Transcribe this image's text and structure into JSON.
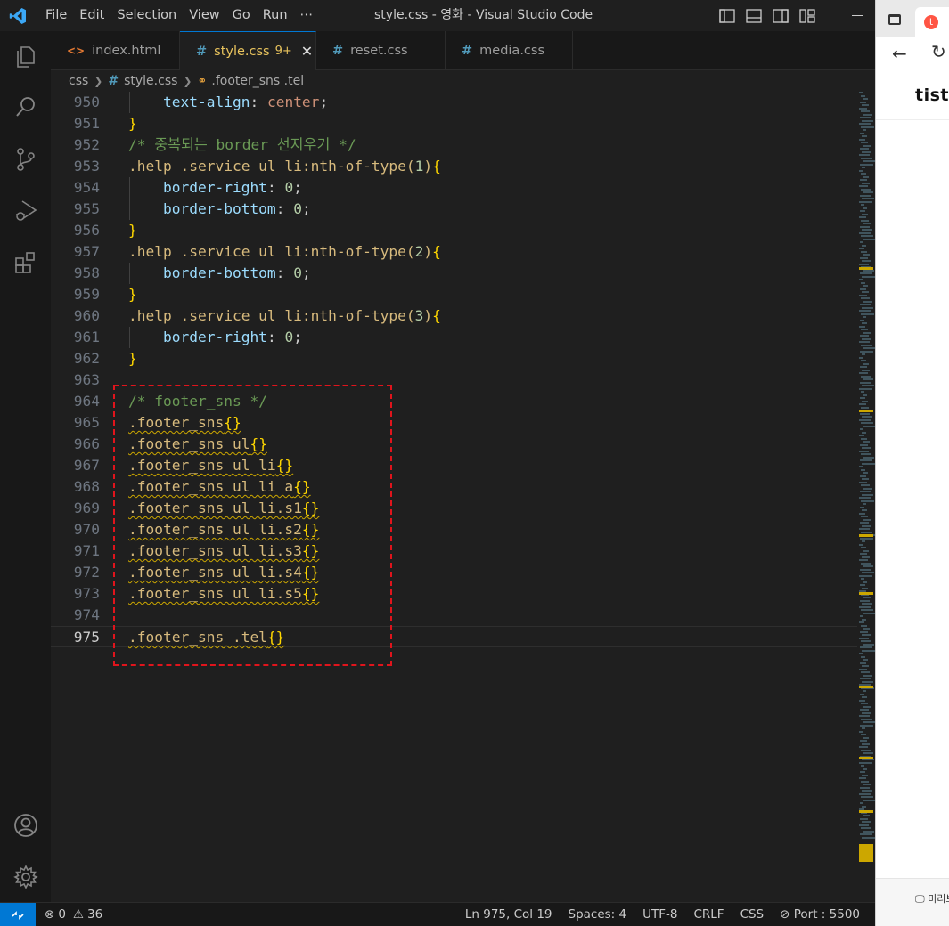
{
  "window": {
    "title": "style.css - 영화 - Visual Studio Code",
    "menu": [
      "File",
      "Edit",
      "Selection",
      "View",
      "Go",
      "Run",
      "⋯"
    ]
  },
  "tabs": [
    {
      "label": "index.html",
      "icon": "html-file-icon",
      "active": false
    },
    {
      "label": "style.css",
      "icon": "css-file-icon",
      "active": true,
      "badge": "9+"
    },
    {
      "label": "reset.css",
      "icon": "css-file-icon",
      "active": false
    },
    {
      "label": "media.css",
      "icon": "css-file-icon",
      "active": false
    }
  ],
  "breadcrumb": {
    "folder": "css",
    "file": "style.css",
    "symbol": ".footer_sns .tel"
  },
  "editor": {
    "lines": [
      {
        "n": "950",
        "ind": true,
        "t": [
          [
            "prop",
            "text-align"
          ],
          [
            "punc",
            ": "
          ],
          [
            "val",
            "center"
          ],
          [
            "punc",
            ";"
          ]
        ]
      },
      {
        "n": "951",
        "ind": false,
        "t": [
          [
            "brace",
            "}"
          ]
        ]
      },
      {
        "n": "952",
        "ind": false,
        "t": [
          [
            "com",
            "/* 중복되는 border 선지우기 */"
          ]
        ]
      },
      {
        "n": "953",
        "ind": false,
        "t": [
          [
            "sel",
            ".help .service ul li:nth-of-type("
          ],
          [
            "num",
            "1"
          ],
          [
            "sel",
            ")"
          ],
          [
            "brace",
            "{"
          ]
        ]
      },
      {
        "n": "954",
        "ind": true,
        "t": [
          [
            "prop",
            "border-right"
          ],
          [
            "punc",
            ": "
          ],
          [
            "num",
            "0"
          ],
          [
            "punc",
            ";"
          ]
        ]
      },
      {
        "n": "955",
        "ind": true,
        "t": [
          [
            "prop",
            "border-bottom"
          ],
          [
            "punc",
            ": "
          ],
          [
            "num",
            "0"
          ],
          [
            "punc",
            ";"
          ]
        ]
      },
      {
        "n": "956",
        "ind": false,
        "t": [
          [
            "brace",
            "}"
          ]
        ]
      },
      {
        "n": "957",
        "ind": false,
        "t": [
          [
            "sel",
            ".help .service ul li:nth-of-type("
          ],
          [
            "num",
            "2"
          ],
          [
            "sel",
            ")"
          ],
          [
            "brace",
            "{"
          ]
        ]
      },
      {
        "n": "958",
        "ind": true,
        "t": [
          [
            "prop",
            "border-bottom"
          ],
          [
            "punc",
            ": "
          ],
          [
            "num",
            "0"
          ],
          [
            "punc",
            ";"
          ]
        ]
      },
      {
        "n": "959",
        "ind": false,
        "t": [
          [
            "brace",
            "}"
          ]
        ]
      },
      {
        "n": "960",
        "ind": false,
        "t": [
          [
            "sel",
            ".help .service ul li:nth-of-type("
          ],
          [
            "num",
            "3"
          ],
          [
            "sel",
            ")"
          ],
          [
            "brace",
            "{"
          ]
        ]
      },
      {
        "n": "961",
        "ind": true,
        "t": [
          [
            "prop",
            "border-right"
          ],
          [
            "punc",
            ": "
          ],
          [
            "num",
            "0"
          ],
          [
            "punc",
            ";"
          ]
        ]
      },
      {
        "n": "962",
        "ind": false,
        "t": [
          [
            "brace",
            "}"
          ]
        ]
      },
      {
        "n": "963",
        "ind": false,
        "t": []
      },
      {
        "n": "964",
        "ind": false,
        "t": [
          [
            "com",
            "/* footer_sns */"
          ]
        ]
      },
      {
        "n": "965",
        "ind": false,
        "sq": true,
        "t": [
          [
            "sel",
            ".footer_sns"
          ],
          [
            "brace",
            "{}"
          ]
        ]
      },
      {
        "n": "966",
        "ind": false,
        "sq": true,
        "t": [
          [
            "sel",
            ".footer_sns ul"
          ],
          [
            "brace",
            "{}"
          ]
        ]
      },
      {
        "n": "967",
        "ind": false,
        "sq": true,
        "t": [
          [
            "sel",
            ".footer_sns ul li"
          ],
          [
            "brace",
            "{}"
          ]
        ]
      },
      {
        "n": "968",
        "ind": false,
        "sq": true,
        "t": [
          [
            "sel",
            ".footer_sns ul li a"
          ],
          [
            "brace",
            "{}"
          ]
        ]
      },
      {
        "n": "969",
        "ind": false,
        "sq": true,
        "t": [
          [
            "sel",
            ".footer_sns ul li.s1"
          ],
          [
            "brace",
            "{}"
          ]
        ]
      },
      {
        "n": "970",
        "ind": false,
        "sq": true,
        "t": [
          [
            "sel",
            ".footer_sns ul li.s2"
          ],
          [
            "brace",
            "{}"
          ]
        ]
      },
      {
        "n": "971",
        "ind": false,
        "sq": true,
        "t": [
          [
            "sel",
            ".footer_sns ul li.s3"
          ],
          [
            "brace",
            "{}"
          ]
        ]
      },
      {
        "n": "972",
        "ind": false,
        "sq": true,
        "t": [
          [
            "sel",
            ".footer_sns ul li.s4"
          ],
          [
            "brace",
            "{}"
          ]
        ]
      },
      {
        "n": "973",
        "ind": false,
        "sq": true,
        "t": [
          [
            "sel",
            ".footer_sns ul li.s5"
          ],
          [
            "brace",
            "{}"
          ]
        ]
      },
      {
        "n": "974",
        "ind": false,
        "t": []
      },
      {
        "n": "975",
        "ind": false,
        "sq": true,
        "current": true,
        "t": [
          [
            "sel",
            ".footer_sns .tel"
          ],
          [
            "brace",
            "{}"
          ]
        ]
      }
    ]
  },
  "browser": {
    "logo_text": "tisto",
    "preview_label": "미리보"
  },
  "statusbar": {
    "errors": "0",
    "warnings": "36",
    "position": "Ln 975, Col 19",
    "spaces": "Spaces: 4",
    "encoding": "UTF-8",
    "eol": "CRLF",
    "language": "CSS",
    "port": "Port : 5500"
  },
  "colors": {
    "accent": "#0078d4",
    "warning_squiggle": "#cca700",
    "highlight_box": "#e0141c"
  }
}
